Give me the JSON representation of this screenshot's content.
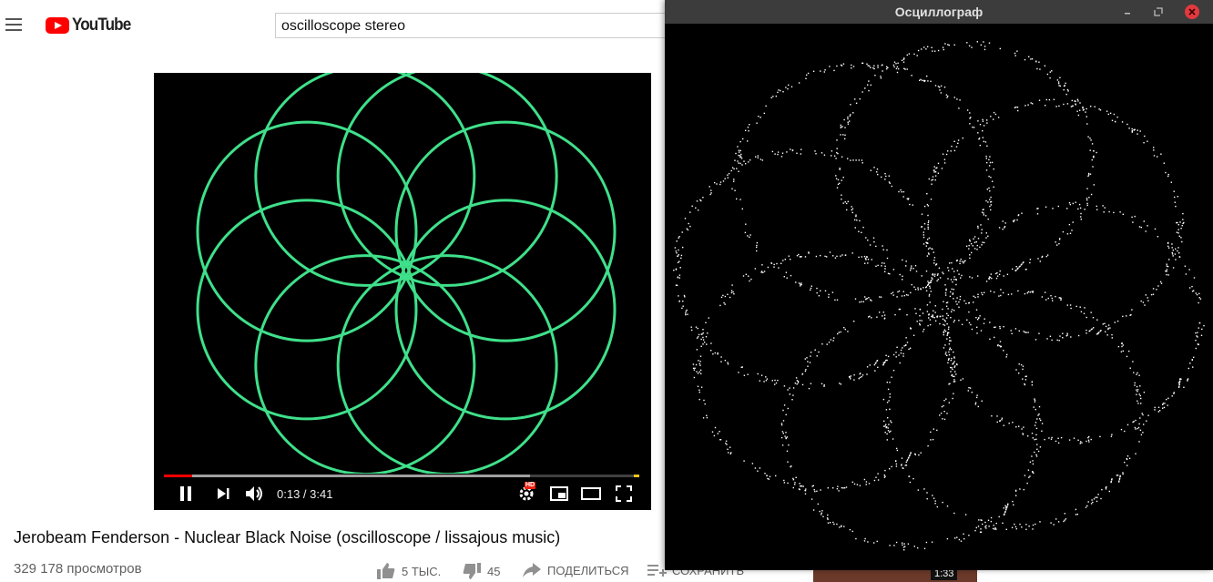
{
  "header": {
    "logo_text": "YouTube",
    "search_value": "oscilloscope stereo"
  },
  "player": {
    "time": "0:13 / 3:41",
    "hd_badge": "HD",
    "played_fraction": 0.059,
    "buffered_fraction": 0.77,
    "trace_color": "#3fe08a"
  },
  "video": {
    "title": "Jerobeam Fenderson - Nuclear Black Noise (oscilloscope / lissajous music)",
    "views": "329 178 просмотров",
    "likes": "5 ТЫС.",
    "dislikes": "45",
    "share_label": "ПОДЕЛИТЬСЯ",
    "save_label": "СОХРАНИТЬ"
  },
  "sidebar_thumb": {
    "duration": "1:33"
  },
  "oscilloscope": {
    "window_title": "Осциллограф",
    "dot_color": "#ffffff"
  },
  "icons": [
    "menu-icon",
    "youtube-logo-icon",
    "pause-icon",
    "next-icon",
    "volume-icon",
    "settings-icon",
    "miniplayer-icon",
    "theater-icon",
    "fullscreen-icon",
    "thumb-up-icon",
    "thumb-down-icon",
    "share-icon",
    "save-icon",
    "minimize-icon",
    "maximize-icon",
    "close-icon"
  ]
}
